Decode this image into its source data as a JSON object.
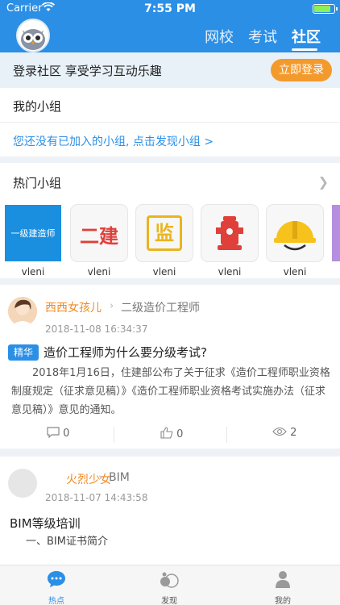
{
  "status_bar": {
    "carrier": "Carrier",
    "time": "7:55 PM"
  },
  "header": {
    "tabs": [
      {
        "label": "网校",
        "active": false
      },
      {
        "label": "考试",
        "active": false
      },
      {
        "label": "社区",
        "active": true
      }
    ]
  },
  "login_banner": {
    "text": "登录社区 享受学习互动乐趣",
    "button": "立即登录"
  },
  "my_group": {
    "title": "我的小组",
    "link": "您还没有已加入的小组, 点击发现小组 >"
  },
  "hot_groups": {
    "title": "热门小组",
    "items": [
      {
        "name": "vleni",
        "logo": "一级建造师"
      },
      {
        "name": "vleni",
        "logo": "二建"
      },
      {
        "name": "vleni",
        "logo": "监"
      },
      {
        "name": "vleni",
        "logo": ""
      },
      {
        "name": "vleni",
        "logo": ""
      }
    ]
  },
  "posts": [
    {
      "user": "西西女孩儿",
      "group": "二级造价工程师",
      "time": "2018-11-08 16:34:37",
      "tag": "精华",
      "title": "造价工程师为什么要分级考试?",
      "body": "2018年1月16日，住建部公布了关于征求《造价工程师职业资格制度规定（征求意见稿）》《造价工程师职业资格考试实施办法（征求意见稿）》意见的通知。",
      "comments": "0",
      "likes": "0",
      "views": "2"
    },
    {
      "user": "火烈少女",
      "group": "BIM",
      "time": "2018-11-07 14:43:58",
      "title": "BIM等级培训",
      "subtitle": "一、BIM证书简介"
    }
  ],
  "tabbar": [
    {
      "label": "热点",
      "icon": "chat-bubble-icon",
      "active": true
    },
    {
      "label": "发现",
      "icon": "discover-icon",
      "active": false
    },
    {
      "label": "我的",
      "icon": "person-icon",
      "active": false
    }
  ],
  "colors": {
    "brand": "#2b8fe6",
    "accent": "#f39a2c",
    "username": "#f08a25"
  }
}
